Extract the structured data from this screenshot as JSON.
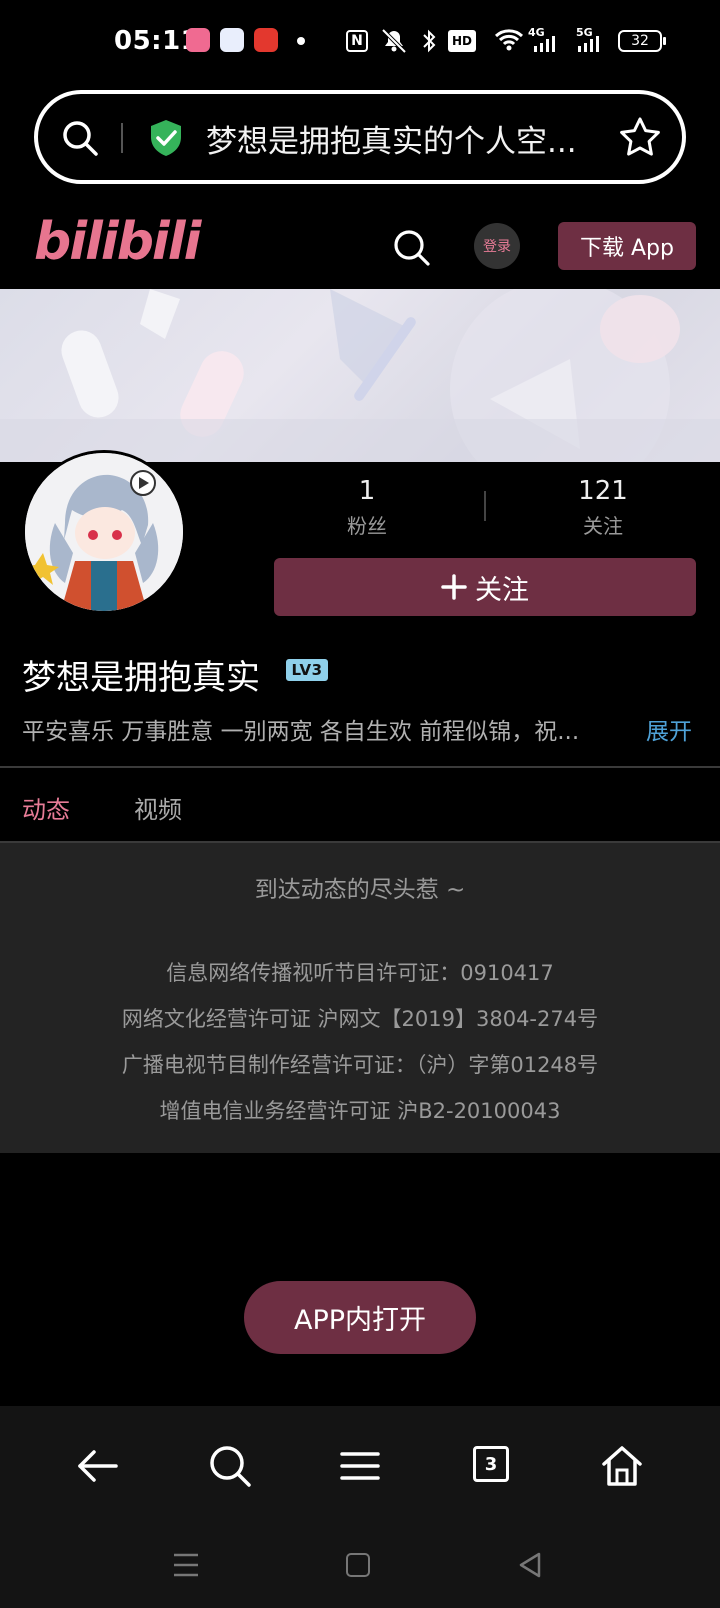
{
  "status_bar": {
    "time": "05:11",
    "network": "4G",
    "network2": "5G",
    "battery": "32"
  },
  "browser": {
    "address_text": "梦想是拥抱真实的个人空...",
    "tabs_count": "3"
  },
  "site_header": {
    "logo": "bilibili",
    "login_label": "登录",
    "download_label": "下载 App"
  },
  "profile": {
    "fans_count": "1",
    "fans_label": "粉丝",
    "following_count": "121",
    "following_label": "关注",
    "follow_button": "关注",
    "username": "梦想是拥抱真实",
    "level": "LV3",
    "bio": "平安喜乐 万事胜意 一别两宽 各自生欢 前程似锦，祝...",
    "expand_label": "展开"
  },
  "tabs": [
    {
      "label": "动态",
      "active": true
    },
    {
      "label": "视频",
      "active": false
    }
  ],
  "feed": {
    "end_message": "到达动态的尽头惹 ~"
  },
  "licenses": [
    "信息网络传播视听节目许可证：0910417",
    "网络文化经营许可证 沪网文【2019】3804-274号",
    "广播电视节目制作经营许可证：（沪）字第01248号",
    "增值电信业务经营许可证 沪B2-20100043"
  ],
  "open_app_label": "APP内打开",
  "colors": {
    "accent_pink": "#e87c97",
    "button_maroon": "#6e2f43",
    "link_blue": "#4fa2d8"
  }
}
